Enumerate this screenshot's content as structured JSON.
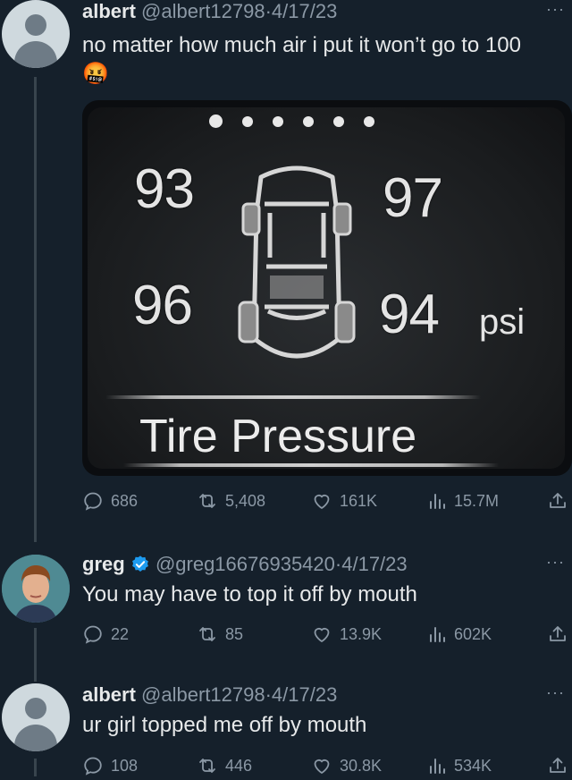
{
  "tweets": [
    {
      "name": "albert",
      "handle": "@albert12798",
      "sep": "·",
      "date": "4/17/23",
      "text": "no matter how much air i put it won’t go to 100",
      "emoji": "🤬",
      "stats": {
        "replies": "686",
        "retweets": "5,408",
        "likes": "161K",
        "views": "15.7M"
      }
    },
    {
      "name": "greg",
      "handle": "@greg16676935420",
      "sep": "·",
      "date": "4/17/23",
      "text": "You may have to top it off by mouth",
      "stats": {
        "replies": "22",
        "retweets": "85",
        "likes": "13.9K",
        "views": "602K"
      }
    },
    {
      "name": "albert",
      "handle": "@albert12798",
      "sep": "·",
      "date": "4/17/23",
      "text": "ur girl topped me off by mouth",
      "stats": {
        "replies": "108",
        "retweets": "446",
        "likes": "30.8K",
        "views": "534K"
      }
    }
  ],
  "more_glyph": "···",
  "media": {
    "front_left": "93",
    "front_right": "97",
    "rear_left": "96",
    "rear_right": "94",
    "unit": "psi",
    "label": "Tire Pressure"
  },
  "colors": {
    "background": "#15202b",
    "secondary_text": "#8b98a5",
    "verified_blue": "#1d9bf0"
  },
  "icons": [
    "reply-icon",
    "retweet-icon",
    "like-icon",
    "views-icon",
    "share-icon",
    "more-icon",
    "verified-icon"
  ]
}
